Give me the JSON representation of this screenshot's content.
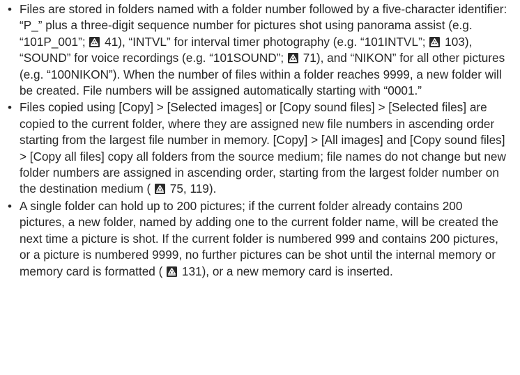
{
  "bullets": [
    {
      "segments": [
        {
          "t": "text",
          "v": "Files are stored in folders named with a folder number followed by a five-character identifier: “P_” plus a three-digit sequence number for pictures shot using panorama assist (e.g. “101P_001”; "
        },
        {
          "t": "icon",
          "v": "page-reference-icon"
        },
        {
          "t": "text",
          "v": " 41), “INTVL” for interval timer photography (e.g. “101INTVL”; "
        },
        {
          "t": "icon",
          "v": "page-reference-icon"
        },
        {
          "t": "text",
          "v": " 103), “SOUND” for voice recordings (e.g. “101SOUND”; "
        },
        {
          "t": "icon",
          "v": "page-reference-icon"
        },
        {
          "t": "text",
          "v": " 71), and “NIKON” for all other pictures (e.g. “100NIKON”). When the number of files within a folder reaches 9999, a new folder will be created. File numbers will be assigned automatically starting with “0001.”"
        }
      ]
    },
    {
      "segments": [
        {
          "t": "text",
          "v": "Files copied using [Copy] > [Selected images] or [Copy sound files] > [Selected files] are copied to the current folder, where they are assigned new file numbers in ascending order starting from the largest file number in memory. [Copy] > [All images] and [Copy sound files] > [Copy all files] copy all folders from the source medium; file names do not change but new folder numbers are assigned in ascending order, starting from the largest folder number on the destination medium ("
        },
        {
          "t": "icon",
          "v": "page-reference-icon"
        },
        {
          "t": "text",
          "v": " 75, 119)."
        }
      ]
    },
    {
      "segments": [
        {
          "t": "text",
          "v": "A single folder can hold up to 200 pictures; if the current folder already contains 200 pictures, a new folder, named by adding one to the current folder name, will be created the next time a picture is shot. If the current folder is numbered 999 and contains 200 pictures, or a picture is numbered 9999, no further pictures can be shot until the internal memory or memory card is formatted ("
        },
        {
          "t": "icon",
          "v": "page-reference-icon"
        },
        {
          "t": "text",
          "v": " 131), or a new memory card is inserted."
        }
      ]
    }
  ],
  "bullet_glyph": "•",
  "colors": {
    "text": "#262626",
    "icon_fill": "#2b2b2b"
  }
}
